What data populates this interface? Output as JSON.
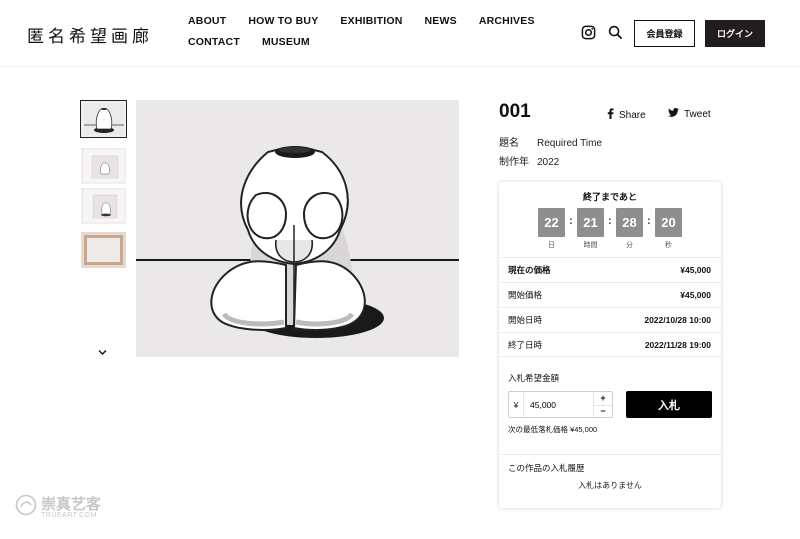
{
  "header": {
    "logo": "匿名希望画廊",
    "nav": [
      "ABOUT",
      "HOW TO BUY",
      "EXHIBITION",
      "NEWS",
      "ARCHIVES",
      "CONTACT",
      "MUSEUM"
    ],
    "register_label": "会員登録",
    "login_label": "ログイン"
  },
  "artwork": {
    "lot_number": "001",
    "share_label": "Share",
    "tweet_label": "Tweet",
    "title_key": "題名",
    "title_value": "Required Time",
    "year_key": "制作年",
    "year_value": "2022"
  },
  "countdown": {
    "title": "終了まであと",
    "days": "22",
    "hours": "21",
    "minutes": "28",
    "seconds": "20",
    "days_unit": "日",
    "hours_unit": "時間",
    "minutes_unit": "分",
    "seconds_unit": "秒"
  },
  "prices": [
    {
      "label": "現在の価格",
      "value": "¥45,000"
    },
    {
      "label": "開始価格",
      "value": "¥45,000"
    },
    {
      "label": "開始日時",
      "value": "2022/10/28 10:00"
    },
    {
      "label": "終了日時",
      "value": "2022/11/28 19:00"
    }
  ],
  "bid": {
    "label": "入札希望金額",
    "currency": "¥",
    "amount": "45,000",
    "plus": "+",
    "minus": "−",
    "button": "入札",
    "min_bid": "次の最低落札価格 ¥45,000"
  },
  "history": {
    "title": "この作品の入札履歴",
    "empty": "入札はありません"
  },
  "watermark": {
    "text": "崇真艺客",
    "sub": "TRUEART.COM"
  }
}
